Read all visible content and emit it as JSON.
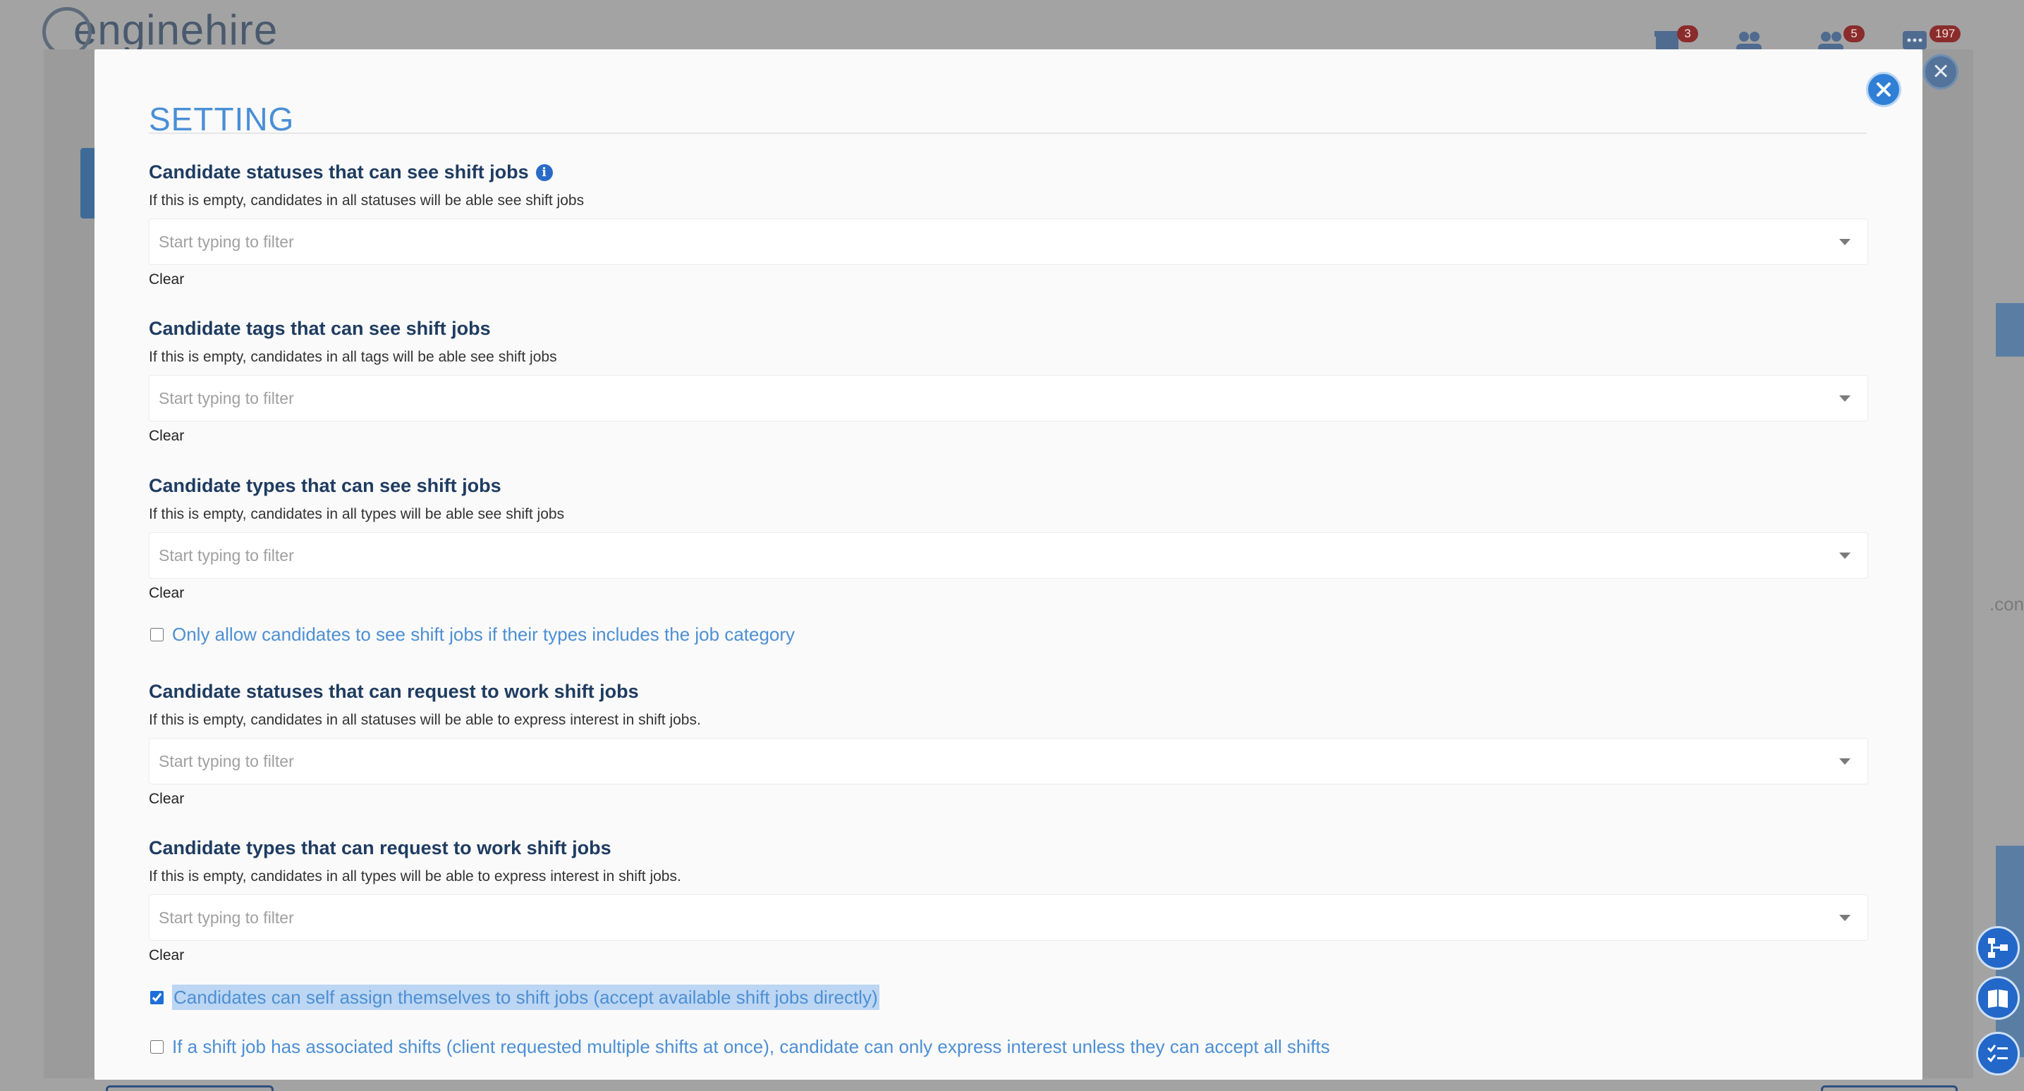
{
  "background": {
    "logo_text": "enginehire",
    "badges": {
      "store": "3",
      "people_alt": "5",
      "messages": "197"
    },
    "url_fragment": ".con"
  },
  "modal": {
    "title": "SETTING",
    "fields": [
      {
        "title": "Candidate statuses that can see shift jobs",
        "help": "If this is empty, candidates in all statuses will be able see shift jobs",
        "placeholder": "Start typing to filter",
        "clear_label": "Clear",
        "has_info": true
      },
      {
        "title": "Candidate tags that can see shift jobs",
        "help": "If this is empty, candidates in all tags will be able see shift jobs",
        "placeholder": "Start typing to filter",
        "clear_label": "Clear",
        "has_info": false
      },
      {
        "title": "Candidate types that can see shift jobs",
        "help": "If this is empty, candidates in all types will be able see shift jobs",
        "placeholder": "Start typing to filter",
        "clear_label": "Clear",
        "has_info": false
      },
      {
        "title": "Candidate statuses that can request to work shift jobs",
        "help": "If this is empty, candidates in all statuses will be able to express interest in shift jobs.",
        "placeholder": "Start typing to filter",
        "clear_label": "Clear",
        "has_info": false
      },
      {
        "title": "Candidate types that can request to work shift jobs",
        "help": "If this is empty, candidates in all types will be able to express interest in shift jobs.",
        "placeholder": "Start typing to filter",
        "clear_label": "Clear",
        "has_info": false
      }
    ],
    "checkboxes": [
      {
        "label": "Only allow candidates to see shift jobs if their types includes the job category",
        "checked": false
      },
      {
        "label": "Candidates can self assign themselves to shift jobs (accept available shift jobs directly)",
        "checked": true
      },
      {
        "label": "If a shift job has associated shifts (client requested multiple shifts at once), candidate can only express interest unless they can accept all shifts",
        "checked": false
      }
    ]
  },
  "colors": {
    "accent": "#2f7fd6",
    "title_text": "#1f3c61",
    "checkbox_label": "#4d8fd3",
    "badge": "#8a2c2c"
  }
}
